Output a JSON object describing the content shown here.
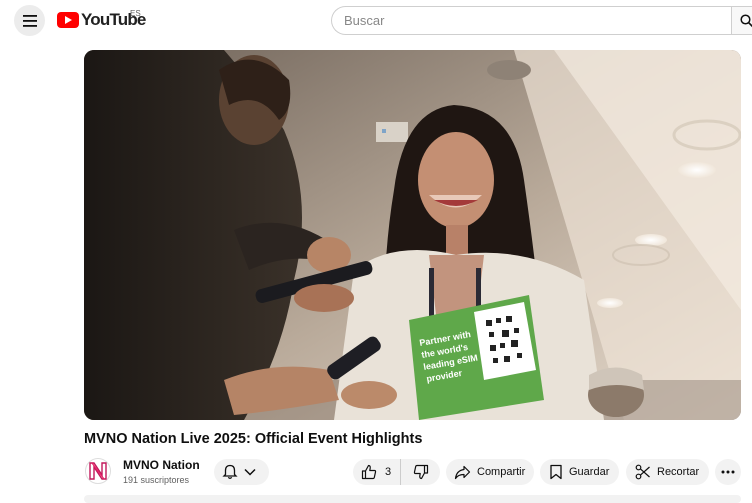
{
  "header": {
    "menu_icon": "hamburger-icon",
    "logo_text": "YouTube",
    "region": "ES",
    "search_placeholder": "Buscar",
    "search_icon": "search-icon"
  },
  "video": {
    "title": "MVNO Nation Live 2025: Official Event Highlights",
    "sign_text": "Partner with the world's leading eSIM provider"
  },
  "channel": {
    "avatar_letter": "N",
    "name": "MVNO Nation",
    "subscribers": "191 suscriptores"
  },
  "actions": {
    "bell_icon": "bell-icon",
    "like_count": "3",
    "share_label": "Compartir",
    "save_label": "Guardar",
    "clip_label": "Recortar",
    "more_icon": "more-horizontal-icon"
  },
  "colors": {
    "brand": "#ff0000",
    "pill_bg": "#f2f2f2",
    "sign_green": "#5fa84a"
  }
}
